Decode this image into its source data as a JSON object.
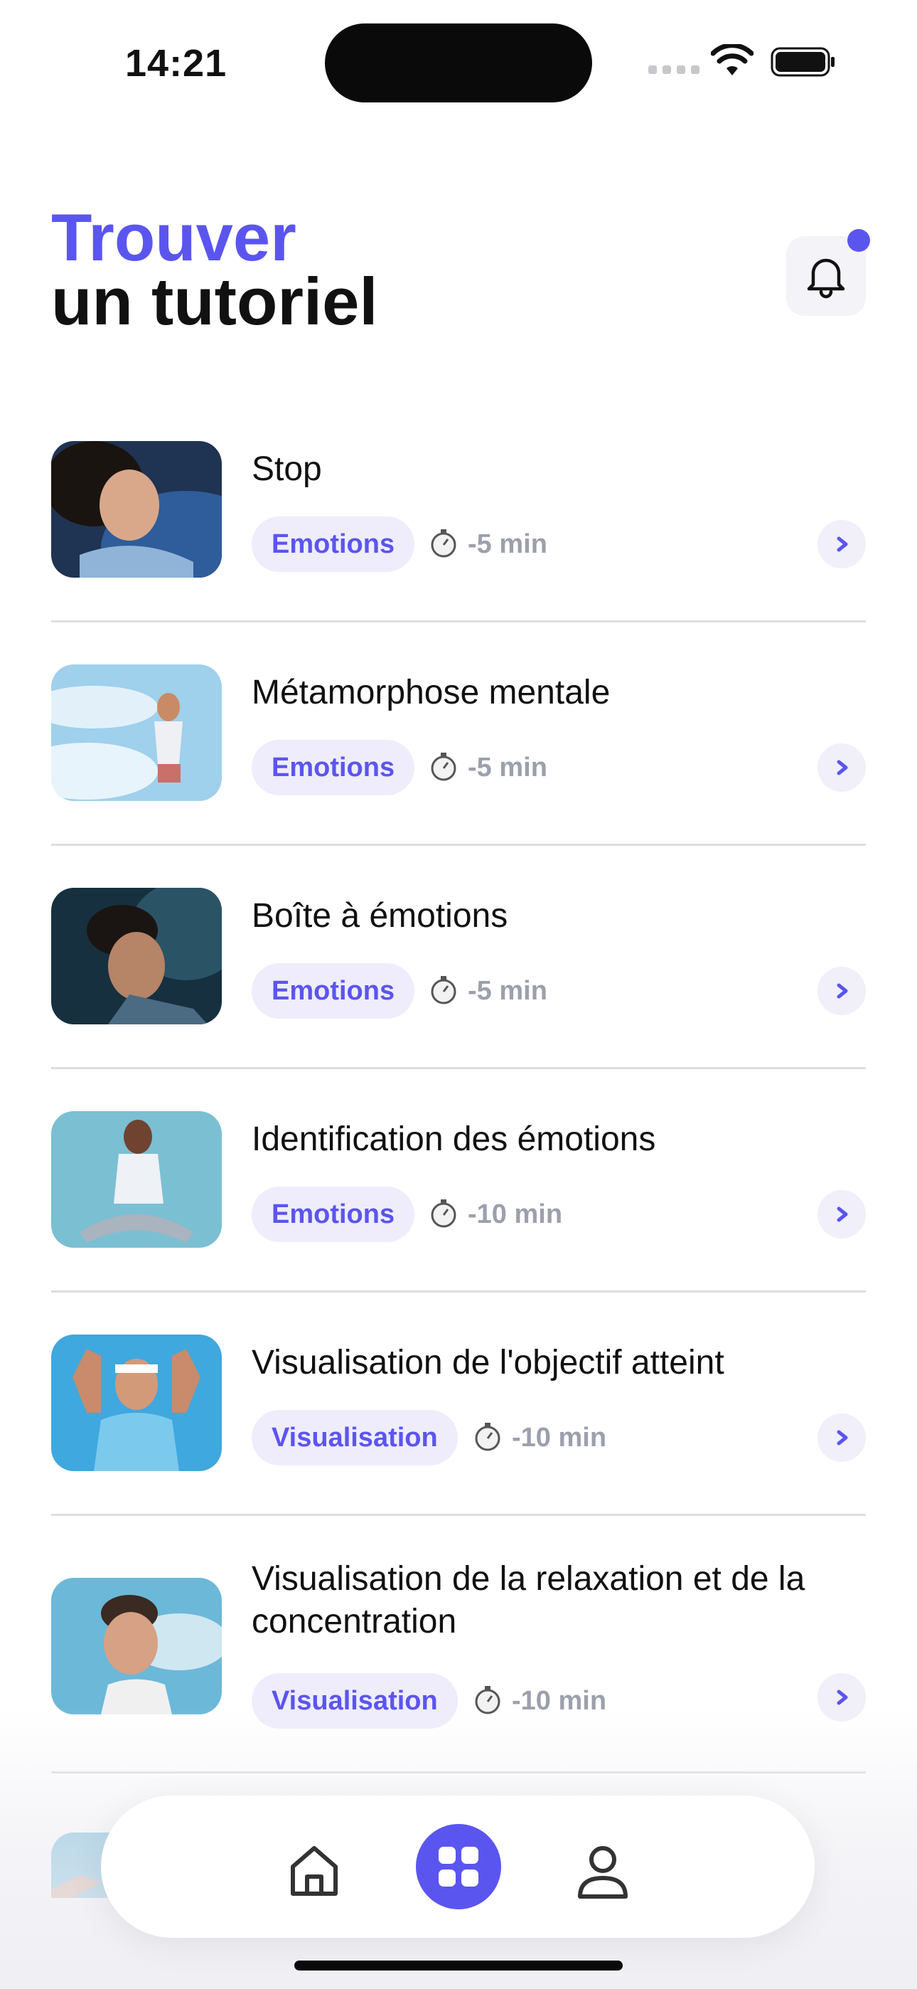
{
  "status_bar": {
    "time": "14:21"
  },
  "header": {
    "title_accent": "Trouver",
    "title_main": "un tutoriel",
    "accent_color": "#5b55f0"
  },
  "tutorials": [
    {
      "title": "Stop",
      "category": "Emotions",
      "duration": "-5 min"
    },
    {
      "title": "Métamorphose mentale",
      "category": "Emotions",
      "duration": "-5 min"
    },
    {
      "title": "Boîte à émotions",
      "category": "Emotions",
      "duration": "-5 min"
    },
    {
      "title": "Identification des émotions",
      "category": "Emotions",
      "duration": "-10 min"
    },
    {
      "title": "Visualisation de l'objectif atteint",
      "category": "Visualisation",
      "duration": "-10 min"
    },
    {
      "title": "Visualisation de la relaxation et de la concentration",
      "category": "Visualisation",
      "duration": "-10 min"
    }
  ],
  "tab_bar": {
    "items": [
      {
        "icon": "home-icon",
        "active": false
      },
      {
        "icon": "grid-icon",
        "active": true
      },
      {
        "icon": "profile-icon",
        "active": false
      }
    ]
  }
}
